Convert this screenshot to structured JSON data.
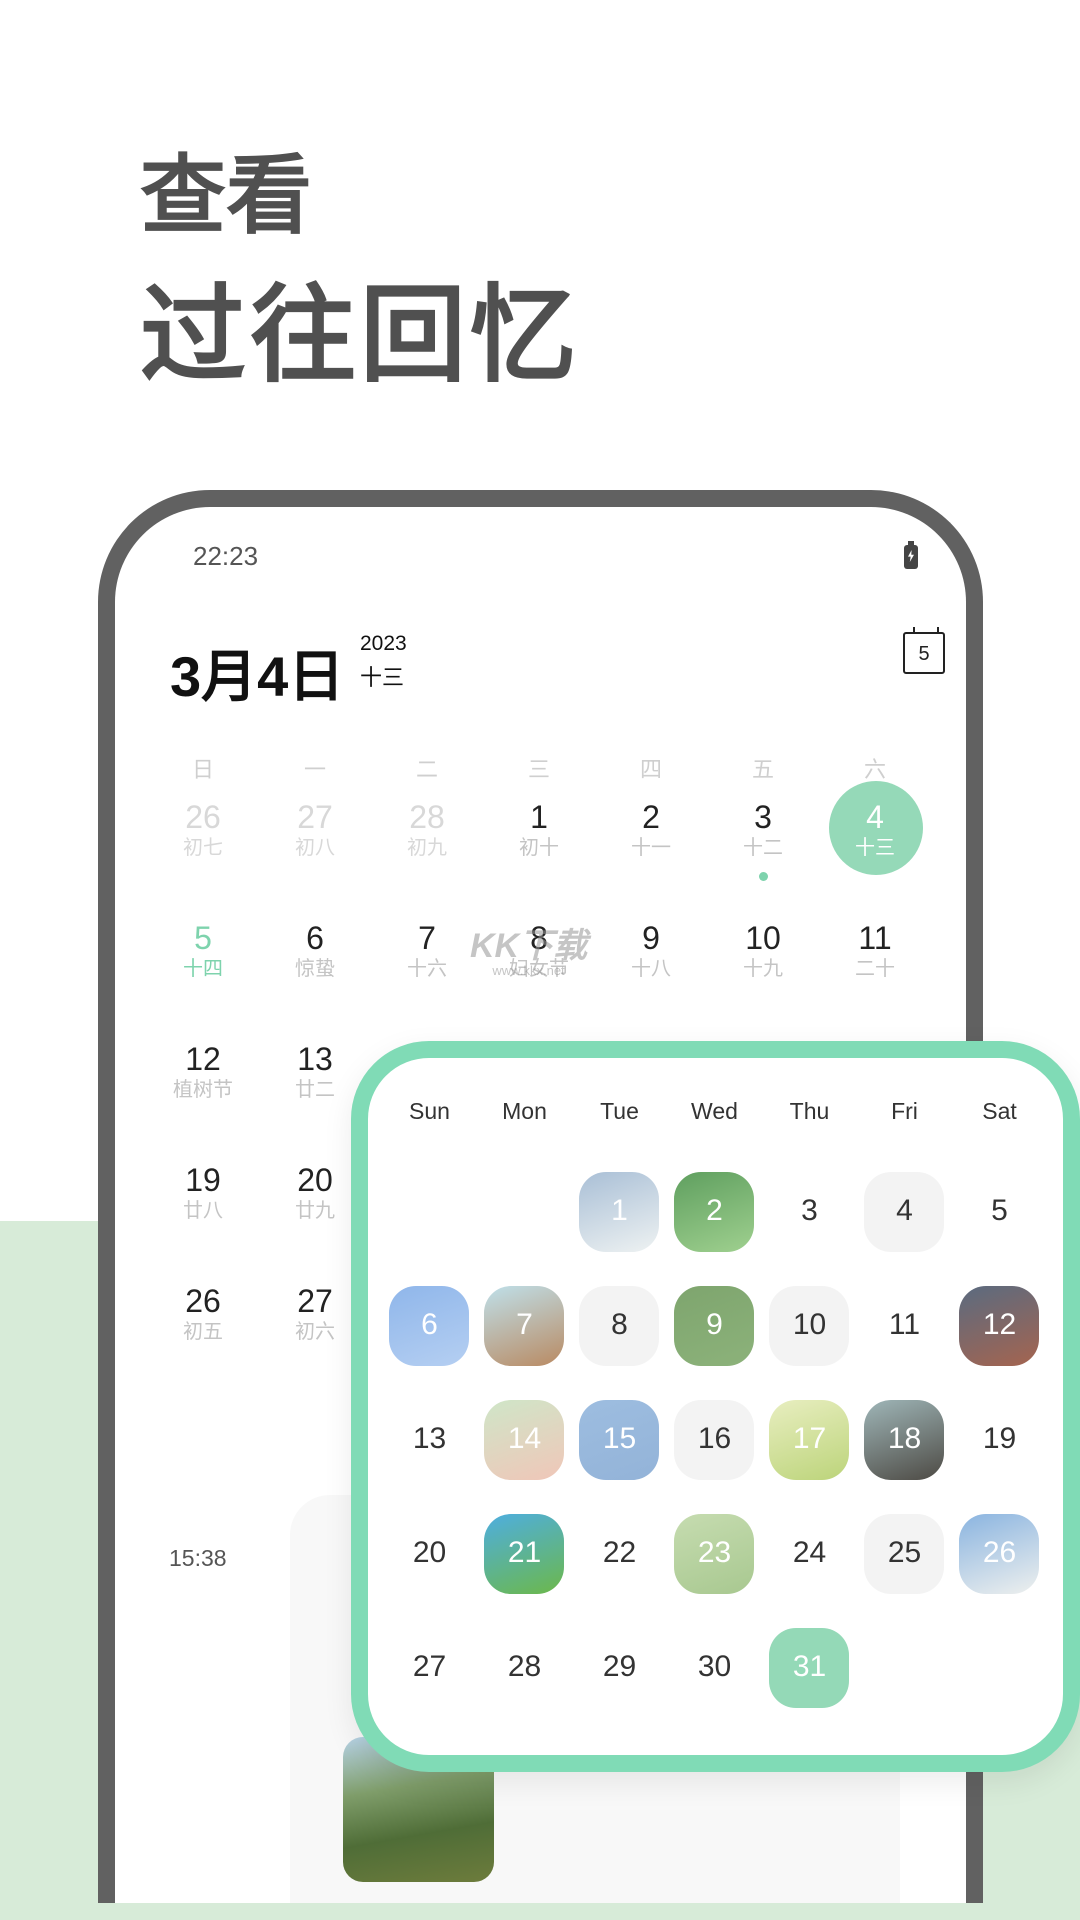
{
  "headline": {
    "line1": "查看",
    "line2": "过往回忆"
  },
  "colors": {
    "accent": "#7ed3ad",
    "overlay_border": "#80dbb6",
    "selected_fill": "#95d9b8",
    "band": "#d7ebd8",
    "frame": "#616161",
    "headline": "#505050"
  },
  "phone": {
    "status_time": "22:23",
    "battery_icon": "battery-charging-icon",
    "header": {
      "date": "3月4日",
      "year": "2023",
      "lunar": "十三",
      "calendar_button_day": "5"
    },
    "weekdays": [
      "日",
      "一",
      "二",
      "三",
      "四",
      "五",
      "六"
    ],
    "month_cells": [
      {
        "day": "26",
        "lunar": "初七",
        "state": "muted"
      },
      {
        "day": "27",
        "lunar": "初八",
        "state": "muted"
      },
      {
        "day": "28",
        "lunar": "初九",
        "state": "muted"
      },
      {
        "day": "1",
        "lunar": "初十",
        "state": "normal"
      },
      {
        "day": "2",
        "lunar": "十一",
        "state": "normal"
      },
      {
        "day": "3",
        "lunar": "十二",
        "state": "normal",
        "has_event": true
      },
      {
        "day": "4",
        "lunar": "十三",
        "state": "selected"
      },
      {
        "day": "5",
        "lunar": "十四",
        "state": "today"
      },
      {
        "day": "6",
        "lunar": "惊蛰",
        "state": "normal"
      },
      {
        "day": "7",
        "lunar": "十六",
        "state": "normal"
      },
      {
        "day": "8",
        "lunar": "妇女节",
        "state": "normal"
      },
      {
        "day": "9",
        "lunar": "十八",
        "state": "normal"
      },
      {
        "day": "10",
        "lunar": "十九",
        "state": "normal"
      },
      {
        "day": "11",
        "lunar": "二十",
        "state": "normal"
      },
      {
        "day": "12",
        "lunar": "植树节",
        "state": "normal"
      },
      {
        "day": "13",
        "lunar": "廿二",
        "state": "normal"
      },
      null,
      null,
      null,
      null,
      null,
      {
        "day": "19",
        "lunar": "廿八",
        "state": "normal"
      },
      {
        "day": "20",
        "lunar": "廿九",
        "state": "normal"
      },
      null,
      null,
      null,
      null,
      null,
      {
        "day": "26",
        "lunar": "初五",
        "state": "normal"
      },
      {
        "day": "27",
        "lunar": "初六",
        "state": "normal"
      }
    ],
    "event": {
      "time": "15:38"
    }
  },
  "watermark": {
    "line1": "KK下载",
    "line2": "www.kkx.net"
  },
  "overlay_calendar": {
    "weekdays": [
      "Sun",
      "Mon",
      "Tue",
      "Wed",
      "Thu",
      "Fri",
      "Sat"
    ],
    "cells": [
      null,
      null,
      {
        "day": "1",
        "style": "img",
        "fill": [
          "#a9bfd6",
          "#eef2f2"
        ]
      },
      {
        "day": "2",
        "style": "img",
        "fill": [
          "#5f9f5f",
          "#9fd08f"
        ]
      },
      {
        "day": "3",
        "style": "plain"
      },
      {
        "day": "4",
        "style": "gray"
      },
      {
        "day": "5",
        "style": "plain"
      },
      {
        "day": "6",
        "style": "img",
        "fill": [
          "#8fb6ea",
          "#b5cff2"
        ]
      },
      {
        "day": "7",
        "style": "img",
        "fill": [
          "#bfe0ea",
          "#b98a62"
        ]
      },
      {
        "day": "8",
        "style": "gray"
      },
      {
        "day": "9",
        "style": "img",
        "fill": [
          "#7ea56e",
          "#8cb27a"
        ]
      },
      {
        "day": "10",
        "style": "gray"
      },
      {
        "day": "11",
        "style": "plain"
      },
      {
        "day": "12",
        "style": "img",
        "fill": [
          "#5a6b80",
          "#a5644f"
        ]
      },
      {
        "day": "13",
        "style": "plain"
      },
      {
        "day": "14",
        "style": "img",
        "fill": [
          "#cfe6c8",
          "#f0c6b8"
        ]
      },
      {
        "day": "15",
        "style": "img",
        "fill": [
          "#9dbde0",
          "#93b3d8"
        ]
      },
      {
        "day": "16",
        "style": "gray"
      },
      {
        "day": "17",
        "style": "img",
        "fill": [
          "#e8eec0",
          "#bcd47a"
        ]
      },
      {
        "day": "18",
        "style": "img",
        "fill": [
          "#9fb6b8",
          "#4d4a44"
        ]
      },
      {
        "day": "19",
        "style": "plain"
      },
      {
        "day": "20",
        "style": "plain"
      },
      {
        "day": "21",
        "style": "img",
        "fill": [
          "#4eaee0",
          "#6cb84a"
        ]
      },
      {
        "day": "22",
        "style": "plain"
      },
      {
        "day": "23",
        "style": "img",
        "fill": [
          "#c6dcb0",
          "#a8c890"
        ]
      },
      {
        "day": "24",
        "style": "plain"
      },
      {
        "day": "25",
        "style": "gray"
      },
      {
        "day": "26",
        "style": "img",
        "fill": [
          "#8ab4e0",
          "#eef0ee"
        ]
      },
      {
        "day": "27",
        "style": "plain"
      },
      {
        "day": "28",
        "style": "plain"
      },
      {
        "day": "29",
        "style": "plain"
      },
      {
        "day": "30",
        "style": "plain"
      },
      {
        "day": "31",
        "style": "sel"
      }
    ]
  }
}
